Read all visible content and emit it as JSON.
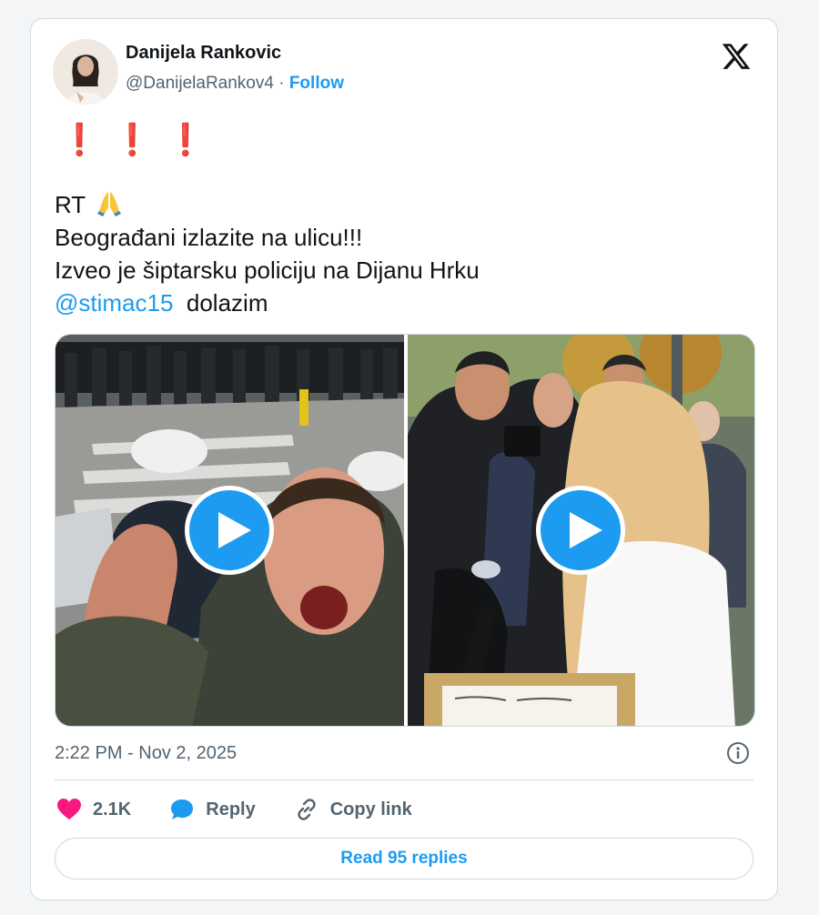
{
  "author": {
    "name": "Danijela Rankovic",
    "handle": "@DanijelaRankov4",
    "separator": "·",
    "follow_label": "Follow"
  },
  "tweet": {
    "emphasis": "❗❗❗",
    "line1": "RT",
    "line1_emoji": "folded-hands-emoji",
    "line2": "Beograđani izlazite na ulicu!!!",
    "line3": "Izveo je šiptarsku policiju na Dijanu Hrku",
    "mention": "@stimac15",
    "line4_rest": "dolazim"
  },
  "media": [
    {
      "type": "video",
      "icon": "play-icon"
    },
    {
      "type": "video",
      "icon": "play-icon"
    }
  ],
  "timestamp": "2:22 PM - Nov 2, 2025",
  "actions": {
    "like_count": "2.1K",
    "reply_label": "Reply",
    "copy_link_label": "Copy link"
  },
  "read_replies_label": "Read 95 replies",
  "colors": {
    "accent": "#1d9bf0",
    "like": "#f91880",
    "text": "#0f1419",
    "muted": "#536471",
    "border": "#cfd9de",
    "alert": "#d9112d"
  }
}
